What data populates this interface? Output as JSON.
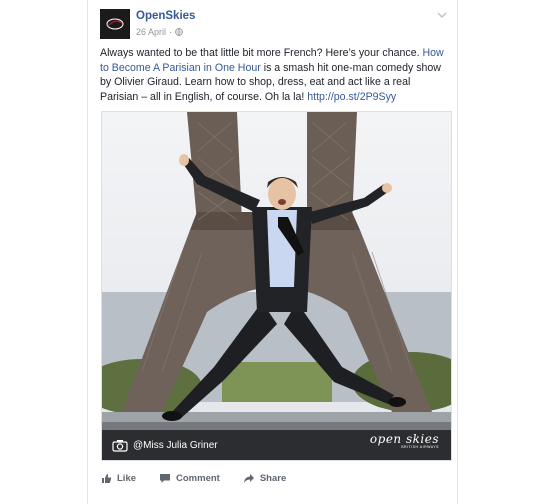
{
  "post": {
    "page_name": "OpenSkies",
    "date": "26 April",
    "separator": "·",
    "caption": {
      "part1": "Always wanted to be that little bit more French? Here’s your chance. ",
      "link_show": "How to Become A Parisian in One Hour",
      "part2": " is a smash hit one-man comedy show by Olivier Giraud. Learn how to shop, dress, eat and act like a real Parisian – all in English, of course. Oh la la! ",
      "link_url": "http://po.st/2P9Syy"
    },
    "photo": {
      "credit": "@Miss Julia Griner",
      "brand": "open skies",
      "brand_sub": "BRITISH AIRWAYS"
    }
  },
  "actions": {
    "like": "Like",
    "comment": "Comment",
    "share": "Share"
  },
  "colors": {
    "link": "#365899",
    "meta": "#90949c",
    "action": "#606770"
  }
}
